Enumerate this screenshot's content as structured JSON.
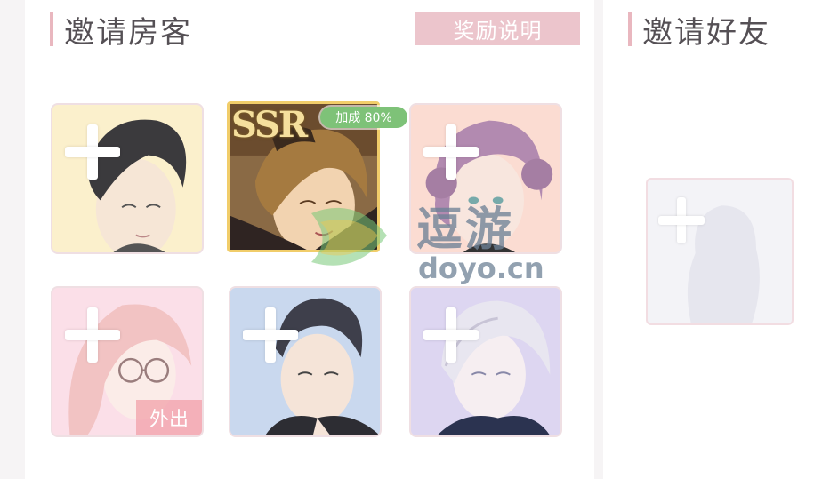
{
  "invite_guests": {
    "title": "邀请房客",
    "reward_button_label": "奖励说明",
    "slots": [
      {
        "tone": "yellow",
        "status": "empty-add"
      },
      {
        "tone": "ssr",
        "rarity": "SSR",
        "bonus_label": "加成 80%",
        "status": "selected"
      },
      {
        "tone": "peach",
        "status": "empty-add"
      },
      {
        "tone": "pink",
        "status": "empty-add",
        "away_label": "外出"
      },
      {
        "tone": "blue",
        "status": "empty-add"
      },
      {
        "tone": "lavender",
        "status": "empty-add"
      }
    ]
  },
  "invite_friends": {
    "title": "邀请好友",
    "slot": {
      "status": "empty-add"
    }
  },
  "watermark": {
    "main": "逗游",
    "sub": "doyo.cn"
  },
  "colors": {
    "title_bar": "#e9b7bf",
    "reward_button_bg": "#ecc5cc",
    "ssr_border": "#f1cd6a",
    "bonus_tag_bg": "#7ec278",
    "yellow_tile": "#fbf0cc",
    "peach_tile": "#fbdcd2",
    "pink_tile": "#fbdfe8",
    "blue_tile": "#c9d8ee",
    "lavender_tile": "#ddd6f1"
  }
}
